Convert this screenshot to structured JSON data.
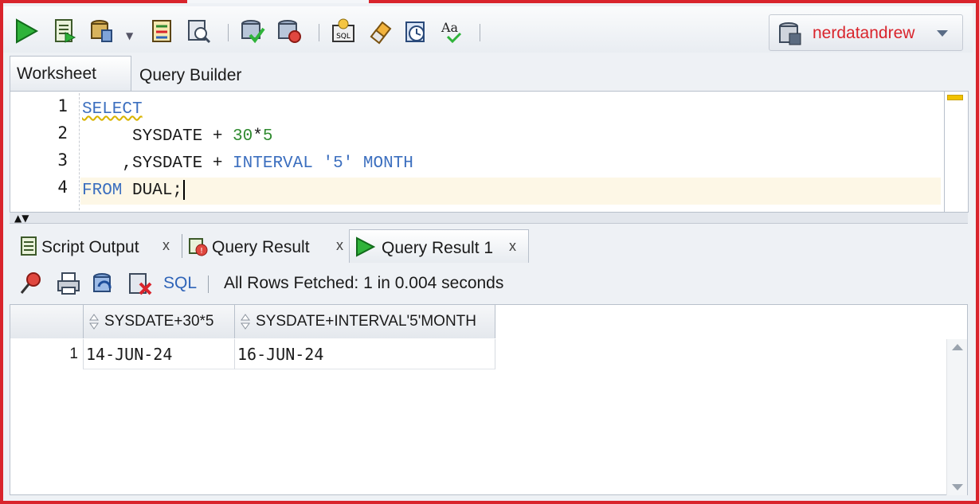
{
  "connection": {
    "name": "nerdatandrew"
  },
  "worksheet_tabs": [
    {
      "label": "Worksheet",
      "active": true
    },
    {
      "label": "Query Builder",
      "active": false
    }
  ],
  "editor": {
    "line_numbers": [
      "1",
      "2",
      "3",
      "4"
    ],
    "lines": [
      {
        "tokens": [
          {
            "t": "SELECT",
            "c": "kw squiggle"
          }
        ]
      },
      {
        "tokens": [
          {
            "t": "     SYSDATE + ",
            "c": "plain"
          },
          {
            "t": "30",
            "c": "num"
          },
          {
            "t": "*",
            "c": "plain"
          },
          {
            "t": "5",
            "c": "num"
          }
        ]
      },
      {
        "tokens": [
          {
            "t": "    ,SYSDATE + ",
            "c": "plain"
          },
          {
            "t": "INTERVAL",
            "c": "kw"
          },
          {
            "t": " '5' ",
            "c": "str"
          },
          {
            "t": "MONTH",
            "c": "kw"
          }
        ]
      },
      {
        "tokens": [
          {
            "t": "FROM",
            "c": "kw"
          },
          {
            "t": " DUAL;",
            "c": "plain"
          }
        ]
      }
    ]
  },
  "result_tabs": [
    {
      "label": "Script Output",
      "close": "x",
      "active": false
    },
    {
      "label": "Query Result",
      "close": "x",
      "active": false
    },
    {
      "label": "Query Result 1",
      "close": "x",
      "active": true
    }
  ],
  "result_toolbar": {
    "sql_label": "SQL",
    "status": "All Rows Fetched: 1 in 0.004 seconds"
  },
  "grid": {
    "columns": [
      "SYSDATE+30*5",
      "SYSDATE+INTERVAL'5'MONTH"
    ],
    "rows": [
      {
        "num": "1",
        "cells": [
          "14-JUN-24",
          "16-JUN-24"
        ]
      }
    ]
  },
  "colors": {
    "frame": "#d9242c",
    "keyword": "#3c6fbf",
    "number": "#2f8a2f",
    "connection_text": "#d9242c"
  }
}
